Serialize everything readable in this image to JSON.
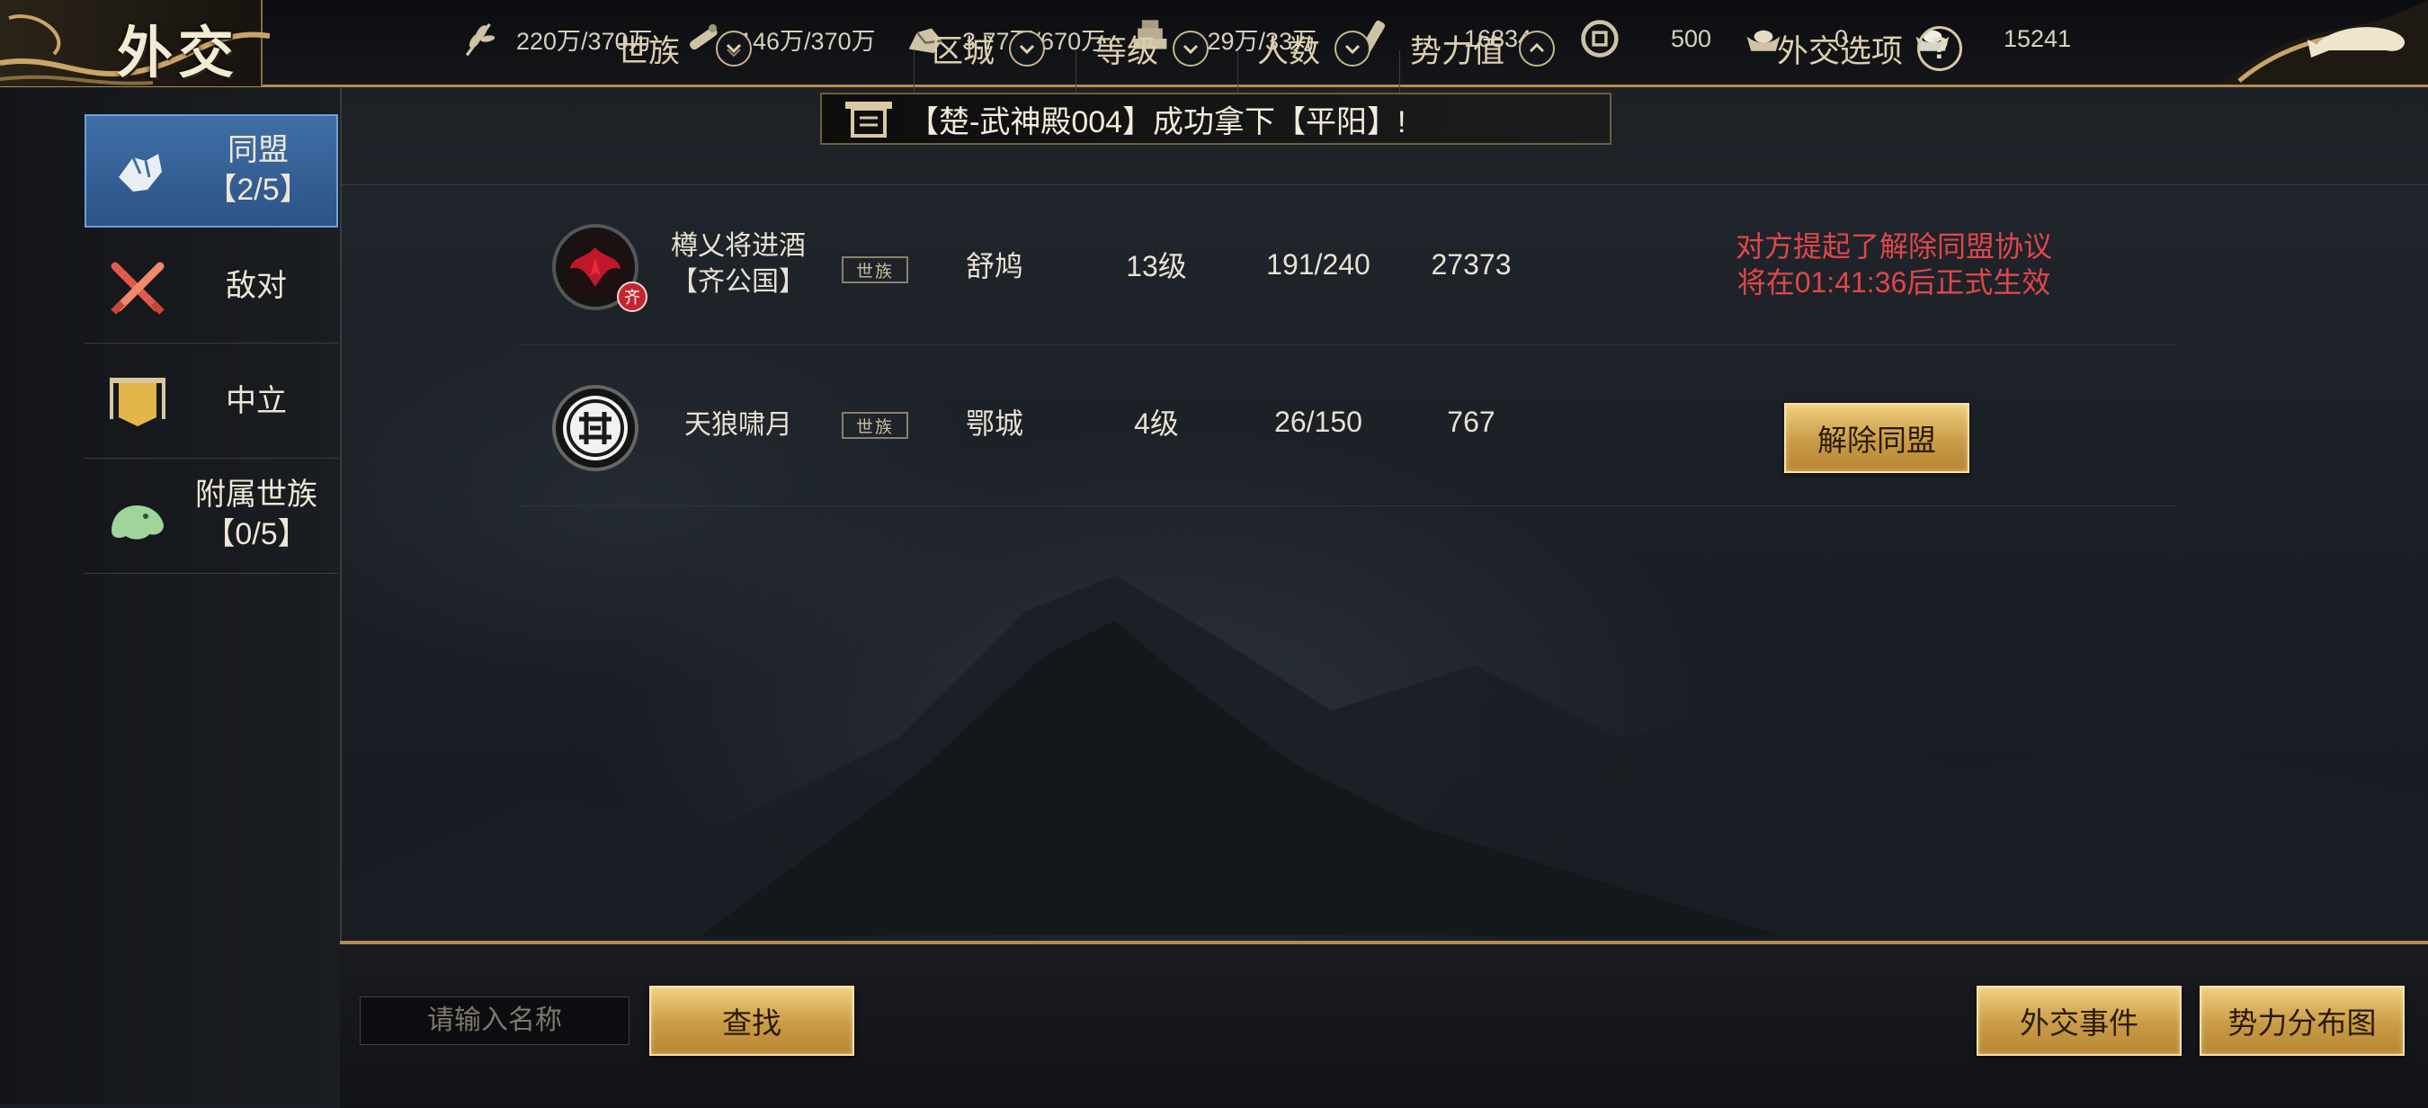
{
  "header": {
    "title": "外交",
    "resources": [
      {
        "icon": "grain-icon",
        "value": "220万/370万"
      },
      {
        "icon": "wood-icon",
        "value": "146万/370万"
      },
      {
        "icon": "stone-icon",
        "value": "3.77万/670万"
      },
      {
        "icon": "iron-icon",
        "value": "4.29万/33万"
      },
      {
        "icon": "order-icon",
        "value": "16834"
      },
      {
        "icon": "copper-coin-icon",
        "value": "500"
      },
      {
        "icon": "gold-ingot-icon",
        "value": "0"
      },
      {
        "icon": "silver-ingot-icon",
        "value": "15241"
      }
    ]
  },
  "sidebar": {
    "items": [
      {
        "label": "同盟",
        "count": "【2/5】",
        "icon": "handshake-icon",
        "active": true
      },
      {
        "label": "敌对",
        "count": "",
        "icon": "crossed-swords-icon",
        "active": false
      },
      {
        "label": "中立",
        "count": "",
        "icon": "banner-icon",
        "active": false
      },
      {
        "label": "附属世族",
        "count": "【0/5】",
        "icon": "cloud-beast-icon",
        "active": false
      }
    ]
  },
  "table": {
    "columns": {
      "clan": "世族",
      "city": "区城",
      "level": "等级",
      "members": "人数",
      "power": "势力值",
      "options": "外交选项"
    },
    "ticker": "【楚-武神殿004】成功拿下【平阳】!",
    "rows": [
      {
        "name": "樽乂将进酒",
        "sub": "【齐公国】",
        "emblem": "phoenix-emblem-icon",
        "badge": "齐",
        "tag": "世族",
        "city": "舒鸠",
        "level": "13级",
        "members": "191/240",
        "power": "27373",
        "status_line1": "对方提起了解除同盟协议",
        "status_line2": "将在01:41:36后正式生效"
      },
      {
        "name": "天狼啸月",
        "sub": "",
        "emblem": "seal-emblem-icon",
        "tag": "世族",
        "city": "鄂城",
        "level": "4级",
        "members": "26/150",
        "power": "767",
        "action_label": "解除同盟"
      }
    ]
  },
  "footer": {
    "search_placeholder": "请输入名称",
    "search_button": "查找",
    "events_button": "外交事件",
    "map_button": "势力分布图"
  },
  "colors": {
    "gold_accent": "#b08d52",
    "active_tab": "#3f6fa6",
    "warning_red": "#e0474a"
  }
}
